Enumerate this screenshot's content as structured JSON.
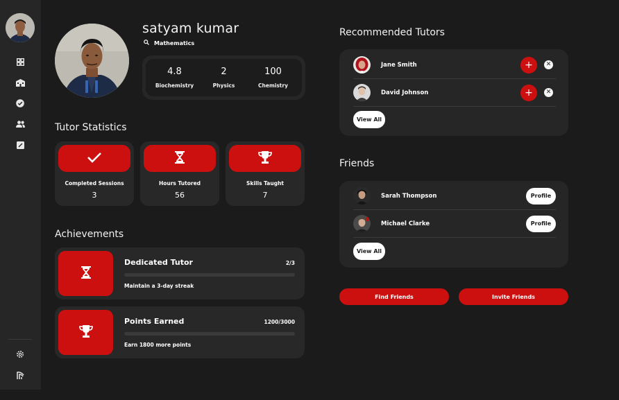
{
  "profile": {
    "name": "satyam kumar",
    "subject": "Mathematics",
    "stats": [
      {
        "value": "4.8",
        "label": "Biochemistry"
      },
      {
        "value": "2",
        "label": "Physics"
      },
      {
        "value": "100",
        "label": "Chemistry"
      }
    ]
  },
  "sidebar": {
    "icons": [
      "dashboard-icon",
      "school-icon",
      "verified-icon",
      "people-icon",
      "assignment-icon"
    ],
    "bottom_icons": [
      "settings-icon",
      "logout-icon"
    ]
  },
  "tutor_statistics": {
    "title": "Tutor Statistics",
    "cards": [
      {
        "icon": "checkmark-icon",
        "label": "Completed Sessions",
        "value": "3"
      },
      {
        "icon": "hourglass-icon",
        "label": "Hours Tutored",
        "value": "56"
      },
      {
        "icon": "trophy-icon",
        "label": "Skills Taught",
        "value": "7"
      }
    ]
  },
  "achievements": {
    "title": "Achievements",
    "items": [
      {
        "icon": "hourglass-icon",
        "title": "Dedicated Tutor",
        "progress_text": "2/3",
        "progress_fraction": 0,
        "description": "Maintain a 3-day streak"
      },
      {
        "icon": "trophy-icon",
        "title": "Points Earned",
        "progress_text": "1200/3000",
        "progress_fraction": 0,
        "description": "Earn 1800 more points"
      }
    ]
  },
  "recommended_tutors": {
    "title": "Recommended Tutors",
    "items": [
      {
        "name": "Jane Smith",
        "add_label": "+"
      },
      {
        "name": "David Johnson",
        "add_label": "+"
      }
    ],
    "view_all": "View All"
  },
  "friends": {
    "title": "Friends",
    "items": [
      {
        "name": "Sarah Thompson",
        "profile_label": "Profile"
      },
      {
        "name": "Michael Clarke",
        "profile_label": "Profile"
      }
    ],
    "view_all": "View All"
  },
  "actions": {
    "find_friends": "Find Friends",
    "invite_friends": "Invite Friends"
  },
  "colors": {
    "background": "#1b1b1b",
    "card": "#262626",
    "accent": "#cc1010"
  }
}
